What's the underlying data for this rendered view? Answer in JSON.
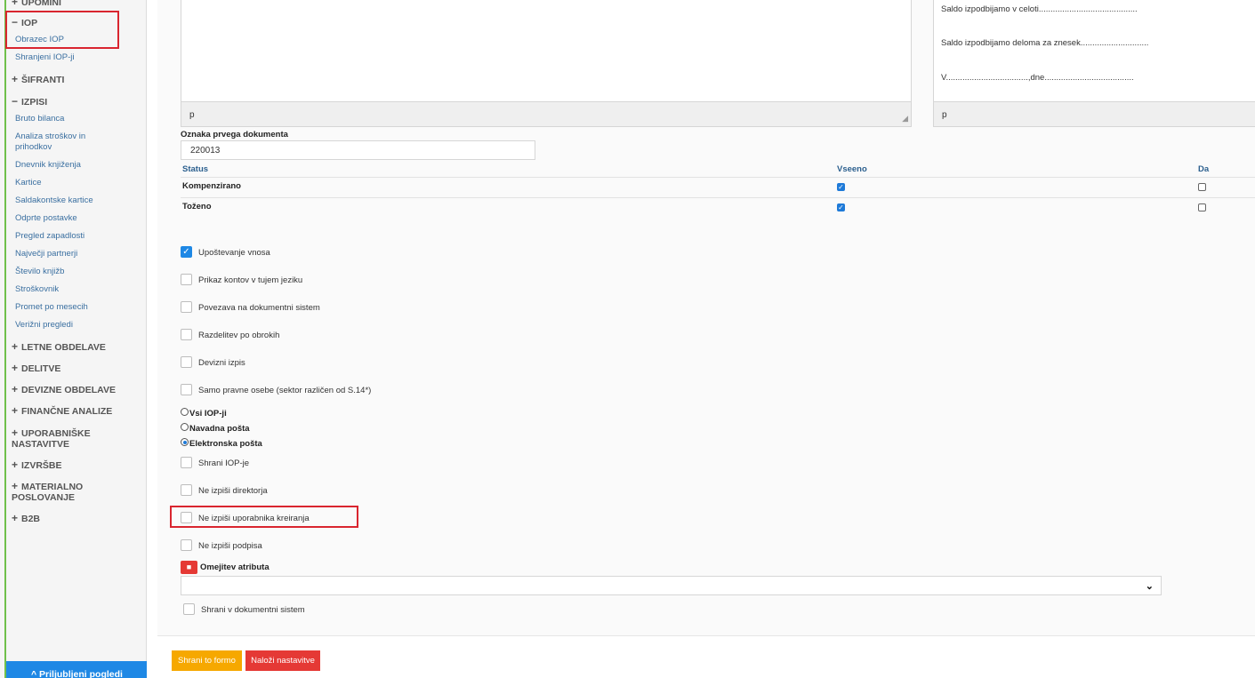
{
  "sidebar": {
    "sections": [
      {
        "symbol": "+",
        "label": "UPOMINI"
      },
      {
        "symbol": "−",
        "label": "IOP"
      },
      {
        "symbol": "+",
        "label": "ŠIFRANTI"
      },
      {
        "symbol": "−",
        "label": "IZPISI"
      },
      {
        "symbol": "+",
        "label": "LETNE OBDELAVE"
      },
      {
        "symbol": "+",
        "label": "DELITVE"
      },
      {
        "symbol": "+",
        "label": "DEVIZNE OBDELAVE"
      },
      {
        "symbol": "+",
        "label": "FINANČNE ANALIZE"
      },
      {
        "symbol": "+",
        "label": "UPORABNIŠKE NASTAVITVE"
      },
      {
        "symbol": "+",
        "label": "IZVRŠBE"
      },
      {
        "symbol": "+",
        "label": "MATERIALNO POSLOVANJE"
      },
      {
        "symbol": "+",
        "label": "B2B"
      }
    ],
    "iop_items": [
      "Obrazec IOP",
      "Shranjeni IOP-ji"
    ],
    "izpisi_items": [
      "Bruto bilanca",
      "Analiza stroškov in prihodkov",
      "Dnevnik knjiženja",
      "Kartice",
      "Saldakontske kartice",
      "Odprte postavke",
      "Pregled zapadlosti",
      "Največji partnerji",
      "Število knjižb",
      "Stroškovnik",
      "Promet po mesecih",
      "Verižni pregledi"
    ],
    "favorites_label": "^ Priljubljeni pogledi"
  },
  "editors": {
    "left_status": "p",
    "right_lines": [
      "Saldo izpodbijamo v celoti..........................................",
      "Saldo izpodbijamo deloma za znesek.............................",
      "V...................................,dne......................................"
    ],
    "right_status": "p"
  },
  "document": {
    "label": "Oznaka prvega dokumenta",
    "value": "220013"
  },
  "status_table": {
    "headers": [
      "Status",
      "Vseeno",
      "Da"
    ],
    "rows": [
      {
        "label": "Kompenzirano",
        "vseeno": true,
        "da": false
      },
      {
        "label": "Toženo",
        "vseeno": true,
        "da": false
      }
    ]
  },
  "options": [
    {
      "label": "Upoštevanje vnosa",
      "checked": true
    },
    {
      "label": "Prikaz kontov v tujem jeziku",
      "checked": false
    },
    {
      "label": "Povezava na dokumentni sistem",
      "checked": false
    },
    {
      "label": "Razdelitev po obrokih",
      "checked": false
    },
    {
      "label": "Devizni izpis",
      "checked": false
    },
    {
      "label": "Samo pravne osebe (sektor različen od S.14*)",
      "checked": false
    }
  ],
  "delivery": [
    {
      "label": "Vsi IOP-ji",
      "selected": false
    },
    {
      "label": "Navadna pošta",
      "selected": false
    },
    {
      "label": "Elektronska pošta",
      "selected": true
    }
  ],
  "options2": [
    {
      "label": "Shrani IOP-je",
      "checked": false
    },
    {
      "label": "Ne izpiši direktorja",
      "checked": false
    },
    {
      "label": "Ne izpiši uporabnika kreiranja",
      "checked": false
    },
    {
      "label": "Ne izpiši podpisa",
      "checked": false
    }
  ],
  "attribute": {
    "label": "Omejitev atributa",
    "value": ""
  },
  "save_to_dms": {
    "label": "Shrani v dokumentni sistem",
    "checked": false
  },
  "buttons": {
    "save_form": "Shrani to formo",
    "load_settings": "Naloži nastavitve"
  },
  "colors": {
    "accent": "#1e88e5",
    "danger": "#e53935",
    "warning": "#f6a800",
    "sidebar_line": "#6fc04b"
  }
}
